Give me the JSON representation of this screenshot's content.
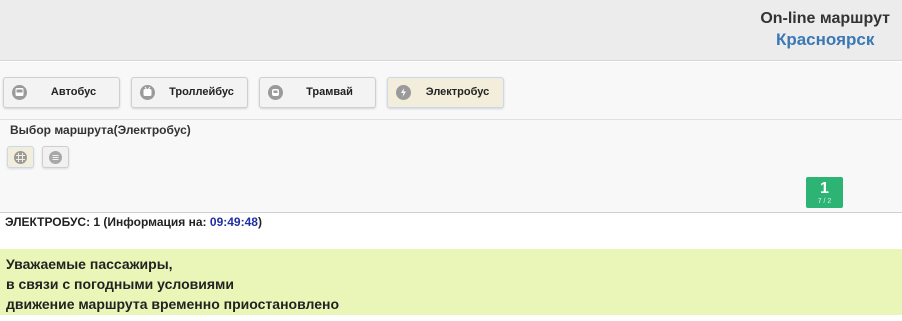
{
  "header": {
    "title": "On-line маршрут",
    "city": "Красноярск"
  },
  "transport": {
    "items": [
      {
        "label": "Автобус",
        "icon": "bus-icon",
        "active": false
      },
      {
        "label": "Троллейбус",
        "icon": "trolleybus-icon",
        "active": false
      },
      {
        "label": "Трамвай",
        "icon": "tram-icon",
        "active": false
      },
      {
        "label": "Электробус",
        "icon": "electrobus-icon",
        "active": true
      }
    ]
  },
  "route_select": {
    "title": "Выбор маршрута(Электробус)",
    "views": [
      {
        "icon": "grid-view-icon",
        "active": true
      },
      {
        "icon": "list-view-icon",
        "active": false
      }
    ],
    "routes": [
      {
        "number": "1",
        "sub": "7 / 2"
      }
    ]
  },
  "info": {
    "prefix": "ЭЛЕКТРОБУС: 1 (Информация на: ",
    "time": "09:49:48",
    "suffix": ")"
  },
  "notice": {
    "lines": [
      "Уважаемые пассажиры,",
      "в связи с погодными условиями",
      "движение маршрута временно приостановлено"
    ]
  },
  "colors": {
    "accent": "#3b78b4",
    "route_badge": "#2db474",
    "notice_bg": "#eaf5b8",
    "time": "#1f2fa3"
  }
}
